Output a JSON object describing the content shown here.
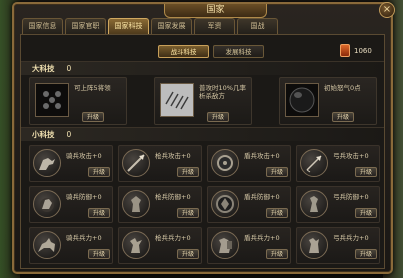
{
  "window": {
    "title": "国家",
    "close_label": "×"
  },
  "tabs": [
    "国家信息",
    "国家官职",
    "国家科技",
    "国家发展",
    "军资",
    "国战"
  ],
  "active_tab": 2,
  "subtabs": [
    "战斗科技",
    "发展科技"
  ],
  "active_subtab": 0,
  "resource": {
    "value": "1060",
    "icon": "resource-token-icon",
    "color": "#e06a2a"
  },
  "big_tech": {
    "label": "大科技",
    "value": "0",
    "items": [
      {
        "desc": "可上阵5将领",
        "icon": "formation-grid-icon",
        "button": "升级"
      },
      {
        "desc": "普攻时10%几率\n析杀敌方",
        "icon": "slash-marks-icon",
        "button": "升级"
      },
      {
        "desc": "初始怒气0点",
        "icon": "dark-orb-icon",
        "button": "升级"
      }
    ]
  },
  "small_tech": {
    "label": "小科技",
    "value": "0",
    "items": [
      {
        "name": "骑兵攻击+0",
        "icon": "cavalry-attack-icon",
        "button": "升级"
      },
      {
        "name": "枪兵攻击+0",
        "icon": "spear-attack-icon",
        "button": "升级"
      },
      {
        "name": "盾兵攻击+0",
        "icon": "shield-attack-icon",
        "button": "升级"
      },
      {
        "name": "弓兵攻击+0",
        "icon": "bow-attack-icon",
        "button": "升级"
      },
      {
        "name": "骑兵防御+0",
        "icon": "cavalry-defense-icon",
        "button": "升级"
      },
      {
        "name": "枪兵防御+0",
        "icon": "spear-defense-icon",
        "button": "升级"
      },
      {
        "name": "盾兵防御+0",
        "icon": "shield-defense-icon",
        "button": "升级"
      },
      {
        "name": "弓兵防御+0",
        "icon": "bow-defense-icon",
        "button": "升级"
      },
      {
        "name": "骑兵兵力+0",
        "icon": "cavalry-troops-icon",
        "button": "升级"
      },
      {
        "name": "枪兵兵力+0",
        "icon": "spear-troops-icon",
        "button": "升级"
      },
      {
        "name": "盾兵兵力+0",
        "icon": "shield-troops-icon",
        "button": "升级"
      },
      {
        "name": "弓兵兵力+0",
        "icon": "bow-troops-icon",
        "button": "升级"
      }
    ]
  }
}
